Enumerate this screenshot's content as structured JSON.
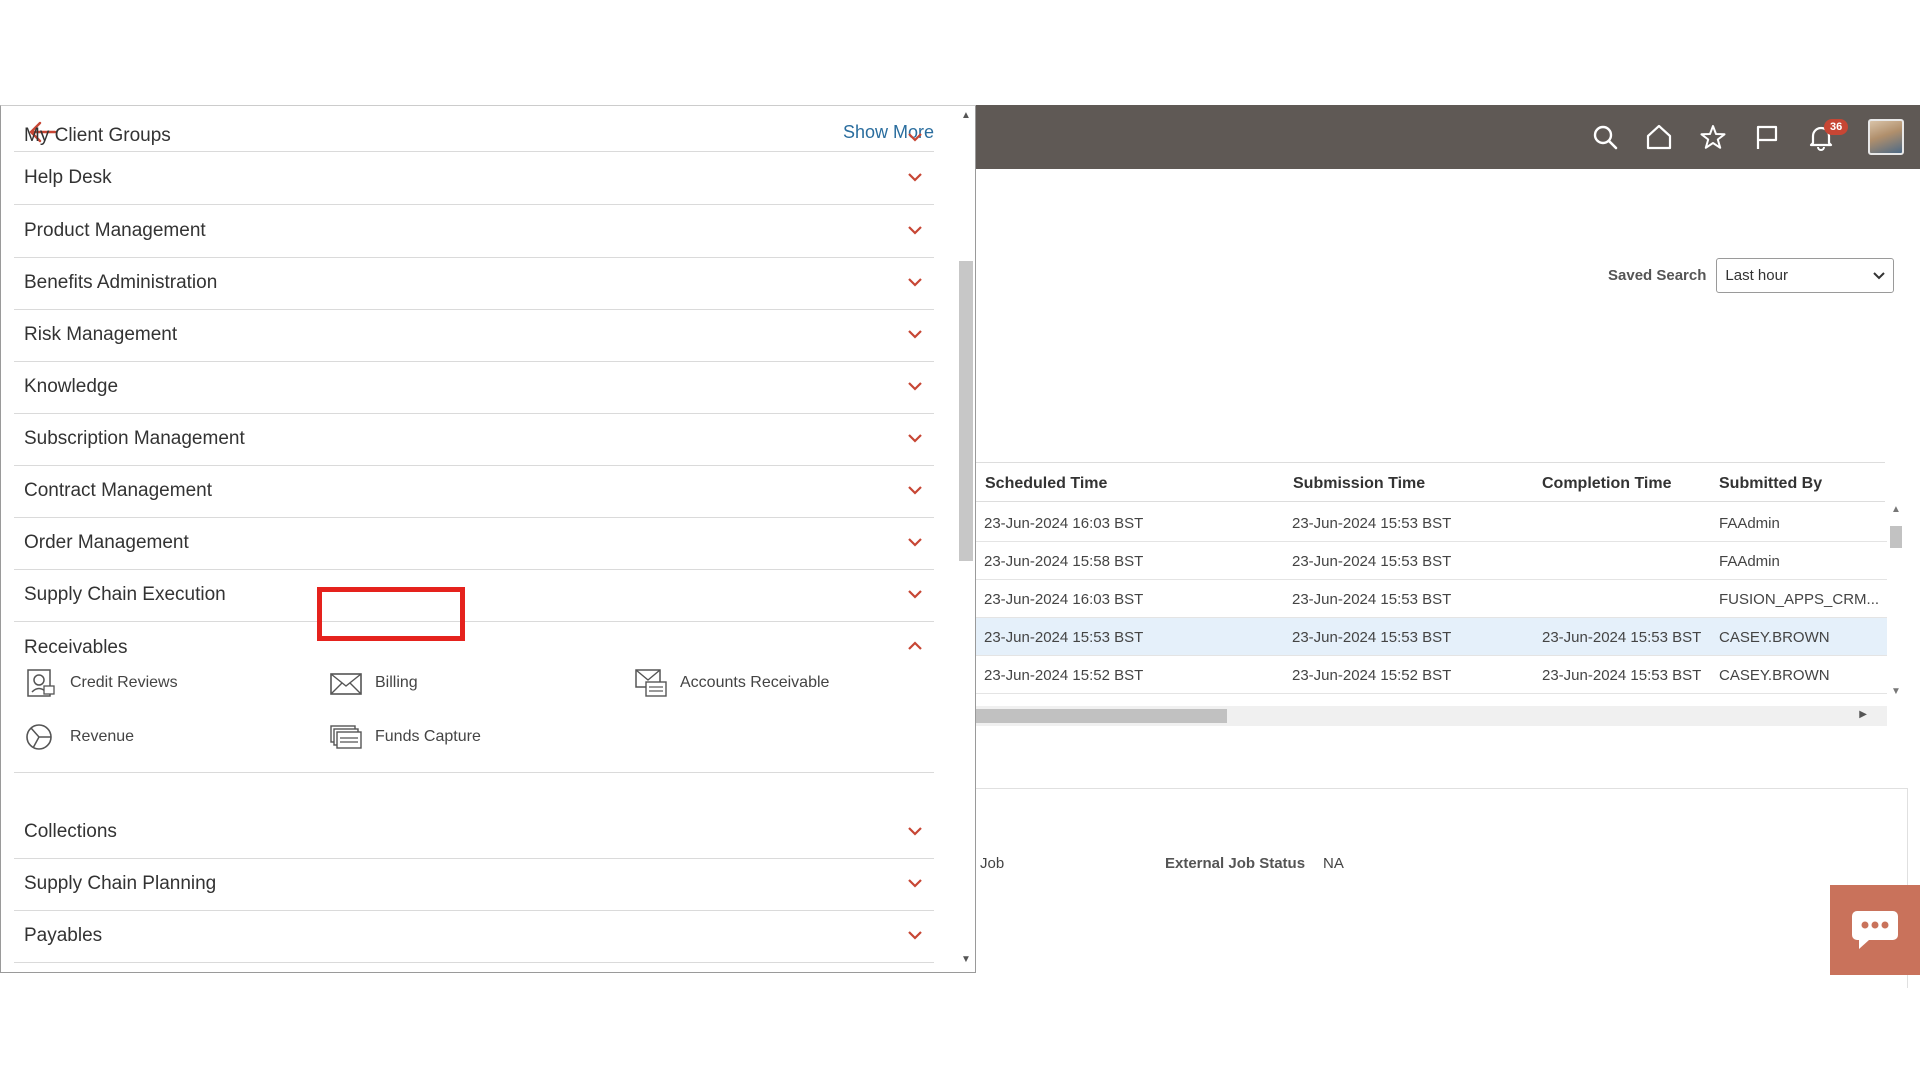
{
  "header": {
    "icons": [
      "search-icon",
      "home-icon",
      "star-icon",
      "flag-icon",
      "bell-icon"
    ],
    "notification_count": "36",
    "accent_color": "#c74634",
    "bar_color": "#5f5955"
  },
  "saved_search": {
    "label": "Saved Search",
    "value": "Last hour"
  },
  "grid": {
    "columns": [
      "Scheduled Time",
      "Submission Time",
      "Completion Time",
      "Submitted By"
    ],
    "rows": [
      {
        "scheduled": "23-Jun-2024 16:03 BST",
        "submission": "23-Jun-2024 15:53 BST",
        "completion": "",
        "submitted_by": "FAAdmin"
      },
      {
        "scheduled": "23-Jun-2024 15:58 BST",
        "submission": "23-Jun-2024 15:53 BST",
        "completion": "",
        "submitted_by": "FAAdmin"
      },
      {
        "scheduled": "23-Jun-2024 16:03 BST",
        "submission": "23-Jun-2024 15:53 BST",
        "completion": "",
        "submitted_by": "FUSION_APPS_CRM..."
      },
      {
        "scheduled": "23-Jun-2024 15:53 BST",
        "submission": "23-Jun-2024 15:53 BST",
        "completion": "23-Jun-2024 15:53 BST",
        "submitted_by": "CASEY.BROWN"
      },
      {
        "scheduled": "23-Jun-2024 15:52 BST",
        "submission": "23-Jun-2024 15:52 BST",
        "completion": "23-Jun-2024 15:53 BST",
        "submitted_by": "CASEY.BROWN"
      }
    ],
    "selected_row_index": 3
  },
  "details": {
    "job_text": "Job",
    "external_job_status_label": "External Job Status",
    "external_job_status_value": "NA"
  },
  "drawer": {
    "show_more": "Show More",
    "menu": {
      "my_client_groups": "My Client Groups",
      "help_desk": "Help Desk",
      "product_management": "Product Management",
      "benefits_administration": "Benefits Administration",
      "risk_management": "Risk Management",
      "knowledge": "Knowledge",
      "subscription_management": "Subscription Management",
      "contract_management": "Contract Management",
      "order_management": "Order Management",
      "supply_chain_execution": "Supply Chain Execution",
      "receivables": "Receivables",
      "collections": "Collections",
      "supply_chain_planning": "Supply Chain Planning",
      "payables": "Payables"
    },
    "receivables_items": {
      "credit_reviews": "Credit Reviews",
      "billing": "Billing",
      "accounts_receivable": "Accounts Receivable",
      "revenue": "Revenue",
      "funds_capture": "Funds Capture"
    }
  }
}
